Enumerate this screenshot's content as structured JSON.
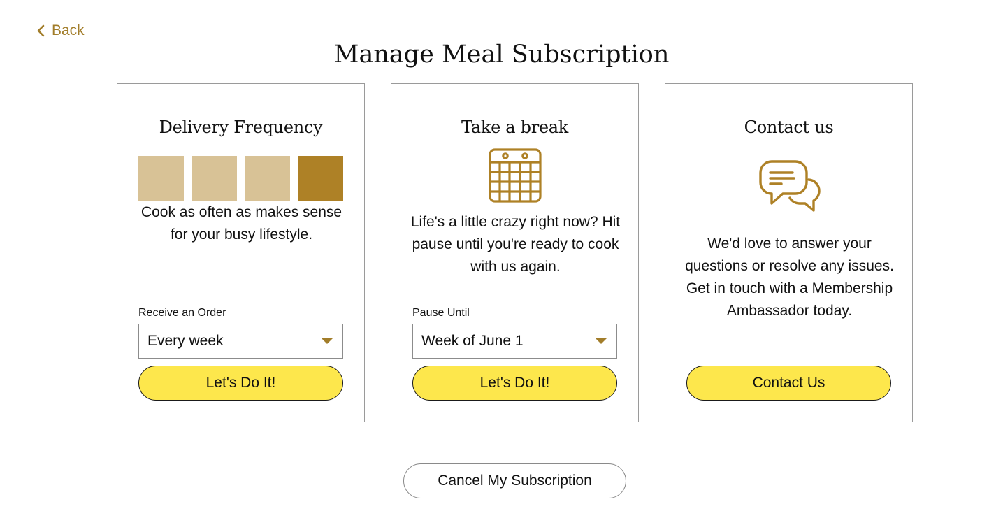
{
  "nav": {
    "back_label": "Back"
  },
  "page_title": "Manage Meal Subscription",
  "colors": {
    "accent": "#a27d2a",
    "button": "#fde74c",
    "square_light": "#d8c296",
    "square_active": "#ae8126"
  },
  "cards": [
    {
      "title": "Delivery Frequency",
      "description": "Cook as often as makes sense for your busy lifestyle.",
      "squares_total": 4,
      "squares_active_index": 3,
      "field_label": "Receive an Order",
      "select_value": "Every week",
      "button_label": "Let's Do It!"
    },
    {
      "title": "Take a break",
      "icon": "calendar-icon",
      "description": "Life's a little crazy right now? Hit pause until you're ready to cook with us again.",
      "field_label": "Pause Until",
      "select_value": "Week of June 1",
      "button_label": "Let's Do It!"
    },
    {
      "title": "Contact us",
      "icon": "chat-bubbles-icon",
      "description": "We'd love to answer your questions or resolve any issues. Get in touch with a Membership Ambassador today.",
      "button_label": "Contact Us"
    }
  ],
  "cancel_label": "Cancel My Subscription"
}
